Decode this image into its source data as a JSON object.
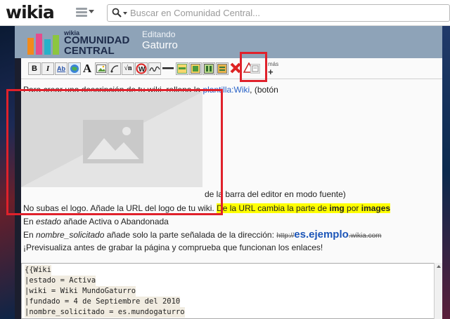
{
  "global_nav": {
    "logo": "wikia",
    "search_placeholder": "Buscar en Comunidad Central..."
  },
  "wiki_header": {
    "logo_small": "wikia",
    "logo_line1": "COMUNIDAD",
    "logo_line2": "CENTRAL",
    "editing_label": "Editando",
    "page_title": "Gaturro"
  },
  "toolbar": {
    "bold": "B",
    "italic": "I",
    "link": "Ab",
    "font": "A",
    "more_label": "más",
    "more_plus": "+"
  },
  "content": {
    "line1_prefix": "Para crear una descripción de tu wiki, rellena la ",
    "line1_link": "plantilla:Wiki",
    "line1_suffix": ", (botón",
    "line2_tail": "de la barra del editor en modo fuente)",
    "line3_plain": "No subas el logo. Añade la URL del logo de tu wiki. ",
    "line3_hl_a": "De la URL cambia la parte de ",
    "line3_hl_b": "img",
    "line3_hl_c": " por ",
    "line3_hl_d": "images",
    "line4_a": "En ",
    "line4_b": "estado",
    "line4_c": " añade Activa o Abandonada",
    "line5_a": "En ",
    "line5_b": "nombre_solicitado",
    "line5_c": " añade solo la parte señalada de la dirección: ",
    "line5_d": "http://",
    "line5_e": "es.ejemplo",
    "line5_f": ".wikia.com",
    "line6": "¡Previsualiza antes de grabar la página y comprueba que funcionan los enlaces!"
  },
  "editor": {
    "lines": [
      "{{Wiki",
      "|estado = Activa",
      "|wiki = Wiki MundoGaturro",
      "|fundado = 4 de Septiembre del 2010",
      "|nombre_solicitado = es.mundogaturro"
    ]
  },
  "colors": {
    "highlight": "#ffff00",
    "annotation": "#e0212b",
    "link": "#2a63c7"
  }
}
